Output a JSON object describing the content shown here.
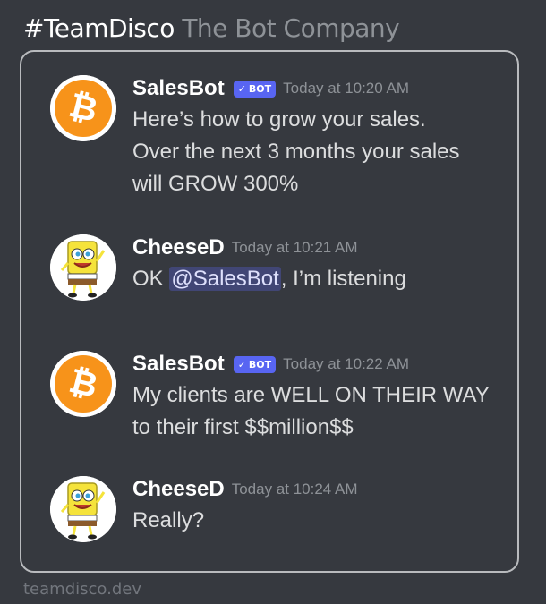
{
  "header": {
    "channel": "#TeamDisco",
    "company": "The Bot Company"
  },
  "messages": [
    {
      "author": "SalesBot",
      "bot": true,
      "bot_tag": "BOT",
      "avatar": "bitcoin-icon",
      "timestamp": "Today at 10:20 AM",
      "text": "Here’s how to grow your sales.\nOver the next 3 months your sales\nwill GROW 300%"
    },
    {
      "author": "CheeseD",
      "bot": false,
      "avatar": "spongebob-avatar",
      "timestamp": "Today at 10:21 AM",
      "text_before": "OK ",
      "mention": "@SalesBot",
      "text_after": ", I’m listening"
    },
    {
      "author": "SalesBot",
      "bot": true,
      "bot_tag": "BOT",
      "avatar": "bitcoin-icon",
      "timestamp": "Today at 10:22 AM",
      "text": "My clients are WELL ON THEIR WAY\nto their first $$million$$"
    },
    {
      "author": "CheeseD",
      "bot": false,
      "avatar": "spongebob-avatar",
      "timestamp": "Today at 10:24 AM",
      "text": "Really?"
    }
  ],
  "footer": {
    "domain": "teamdisco.dev"
  },
  "colors": {
    "background": "#36393f",
    "bot_tag": "#5865f2",
    "mention_bg": "#414675",
    "bitcoin": "#f7931a"
  }
}
